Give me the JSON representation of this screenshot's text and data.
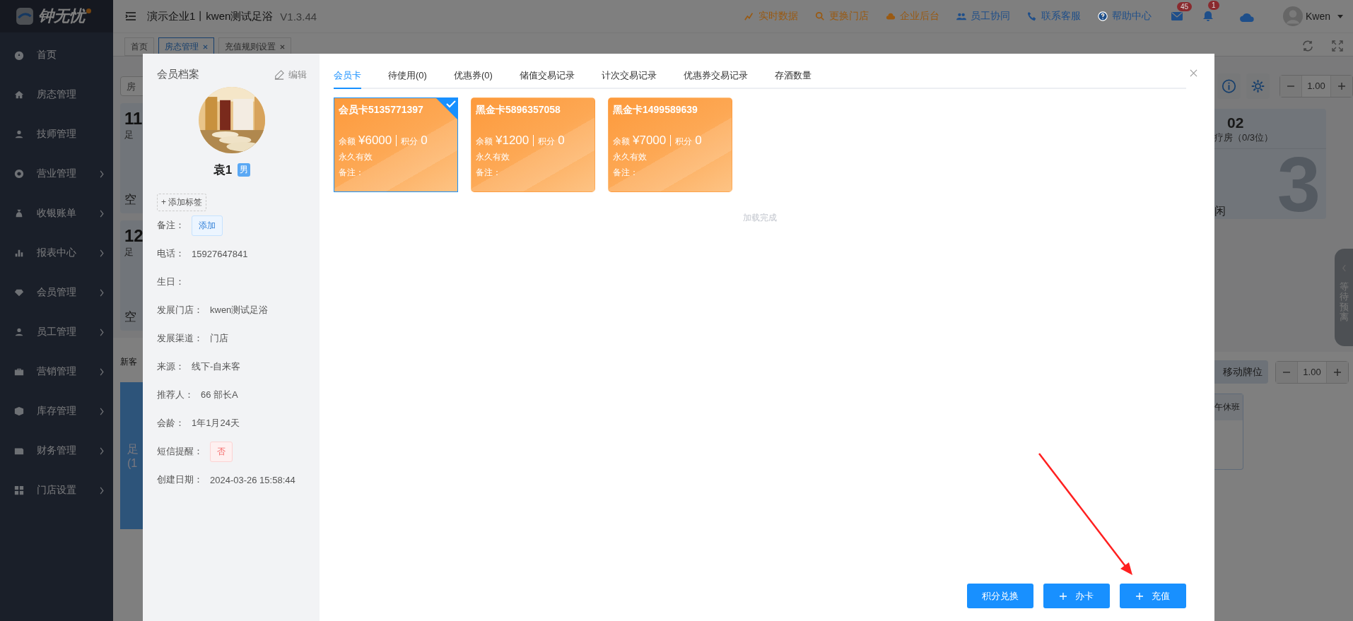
{
  "sidebar": {
    "logo": "钟无忧",
    "items": [
      {
        "label": "首页",
        "expandable": false
      },
      {
        "label": "房态管理",
        "expandable": false
      },
      {
        "label": "技师管理",
        "expandable": false
      },
      {
        "label": "营业管理",
        "expandable": true
      },
      {
        "label": "收银账单",
        "expandable": true
      },
      {
        "label": "报表中心",
        "expandable": true
      },
      {
        "label": "会员管理",
        "expandable": true
      },
      {
        "label": "员工管理",
        "expandable": true
      },
      {
        "label": "营销管理",
        "expandable": true
      },
      {
        "label": "库存管理",
        "expandable": true
      },
      {
        "label": "财务管理",
        "expandable": true
      },
      {
        "label": "门店设置",
        "expandable": true
      }
    ]
  },
  "header": {
    "title": "演示企业1丨kwen测试足浴",
    "version": "V1.3.44",
    "links": [
      {
        "label": "实时数据",
        "color": "#9a5a12"
      },
      {
        "label": "更换门店",
        "color": "#9a5a12"
      },
      {
        "label": "企业后台",
        "color": "#9a5a12"
      },
      {
        "label": "员工协同",
        "color": "#1f4f8a"
      },
      {
        "label": "联系客服",
        "color": "#1f4f8a"
      },
      {
        "label": "帮助中心",
        "color": "#1f4f8a"
      }
    ],
    "mail_badge": "45",
    "bell_badge": "1",
    "user": "Kwen"
  },
  "page_tabs": [
    {
      "label": "首页",
      "selected": false,
      "closable": false
    },
    {
      "label": "房态管理",
      "selected": true,
      "closable": true
    },
    {
      "label": "充值规则设置",
      "selected": false,
      "closable": true
    }
  ],
  "background": {
    "room_filter": "房",
    "rooms_left": [
      {
        "number": "11",
        "type": "足",
        "status": "空"
      },
      {
        "number": "12",
        "type": "足",
        "status": "空"
      }
    ],
    "section_label": "新客",
    "tech_card": [
      "足",
      "(1"
    ],
    "zoom": "1.00",
    "room_right": {
      "number": "02",
      "type": "疗房（0/3位）",
      "count": "3",
      "status": "闲"
    },
    "side_tab": "等待预离",
    "move_button": "移动牌位",
    "zoom2": "1.00",
    "shift": "午休班"
  },
  "modal": {
    "profile": {
      "heading": "会员档案",
      "edit": "编辑",
      "name": "袁1",
      "gender": "男",
      "add_tag": "+ 添加标签",
      "note_label": "备注：",
      "note_button": "添加",
      "fields": [
        {
          "label": "电话：",
          "value": "15927647841"
        },
        {
          "label": "生日："
        },
        {
          "label": "发展门店：",
          "value": "kwen测试足浴"
        },
        {
          "label": "发展渠道：",
          "value": "门店"
        },
        {
          "label": "来源：",
          "value": "线下-自来客"
        },
        {
          "label": "推荐人：",
          "value": "66 部长A"
        },
        {
          "label": "会龄：",
          "value": "1年1月24天"
        }
      ],
      "sms_label": "短信提醒：",
      "sms": "否",
      "created_label": "创建日期：",
      "created": "2024-03-26 15:58:44"
    },
    "tabs": [
      {
        "label": "会员卡",
        "selected": true
      },
      {
        "label": "待使用(0)",
        "selected": false
      },
      {
        "label": "优惠券(0)",
        "selected": false
      },
      {
        "label": "储值交易记录",
        "selected": false
      },
      {
        "label": "计次交易记录",
        "selected": false
      },
      {
        "label": "优惠券交易记录",
        "selected": false
      },
      {
        "label": "存酒数量",
        "selected": false
      }
    ],
    "cards": [
      {
        "title": "会员卡5135771397",
        "balance_label": "余额",
        "balance": "¥6000",
        "points_label": "积分",
        "points": "0",
        "validity": "永久有效",
        "note": "备注：",
        "selected": true
      },
      {
        "title": "黑金卡5896357058",
        "balance_label": "余额",
        "balance": "¥1200",
        "points_label": "积分",
        "points": "0",
        "validity": "永久有效",
        "note": "备注：",
        "selected": false
      },
      {
        "title": "黑金卡1499589639",
        "balance_label": "余额",
        "balance": "¥7000",
        "points_label": "积分",
        "points": "0",
        "validity": "永久有效",
        "note": "备注：",
        "selected": false
      }
    ],
    "load_status": "加载完成",
    "buttons": [
      {
        "label": "积分兑换",
        "plus": false
      },
      {
        "label": "办卡",
        "plus": true
      },
      {
        "label": "充值",
        "plus": true
      }
    ]
  }
}
